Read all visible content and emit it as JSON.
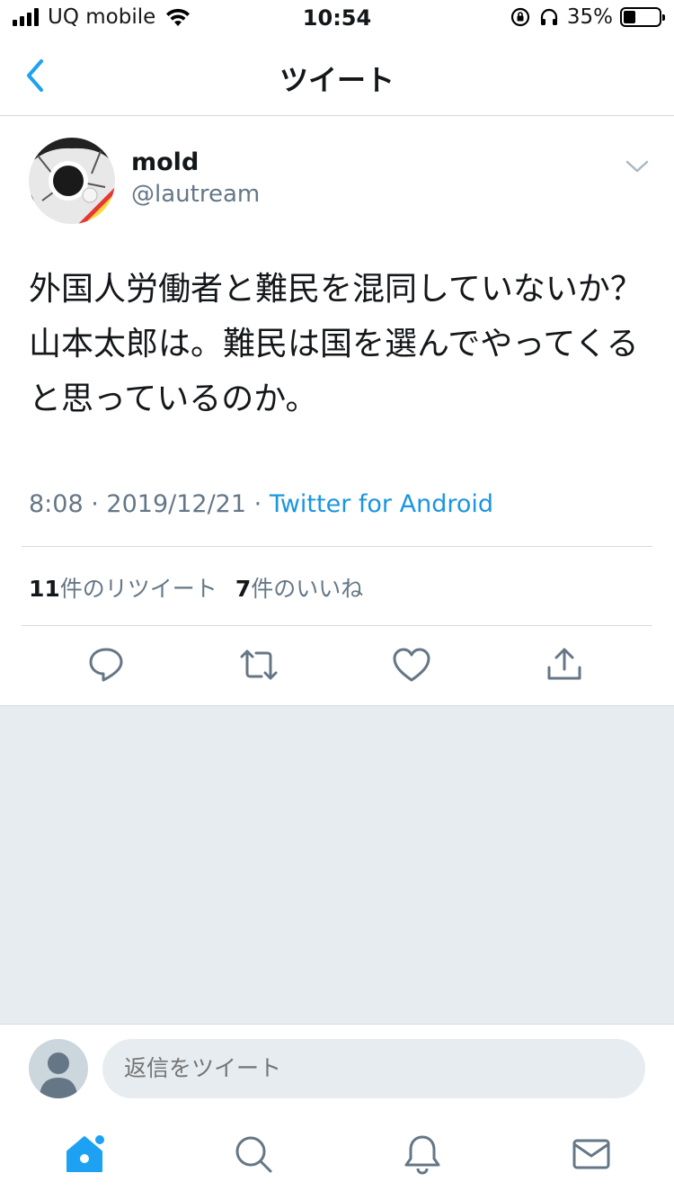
{
  "status_bar": {
    "carrier": "UQ mobile",
    "time": "10:54",
    "battery": "35%",
    "battery_level": 0.35
  },
  "header": {
    "title": "ツイート"
  },
  "tweet": {
    "author_name": "mold",
    "author_handle": "@lautream",
    "text": "外国人労働者と難民を混同していないか？山本太郎は。難民は国を選んでやってくると思っているのか。",
    "time": "8:08",
    "separator": "·",
    "date": "2019/12/21",
    "source": "Twitter for Android",
    "retweet_count": "11",
    "retweet_label": "件のリツイート",
    "like_count": "7",
    "like_label": "件のいいね"
  },
  "reply": {
    "placeholder": "返信をツイート"
  },
  "colors": {
    "accent": "#1da1f2",
    "link": "#1b95e0",
    "secondary_text": "#657786",
    "background_gray": "#e6ecf0"
  },
  "icons": {
    "back": "chevron-left-icon",
    "caret": "chevron-down-icon",
    "reply": "reply-icon",
    "retweet": "retweet-icon",
    "like": "heart-icon",
    "share": "share-icon",
    "home": "home-icon",
    "search": "search-icon",
    "notifications": "bell-icon",
    "messages": "envelope-icon"
  }
}
